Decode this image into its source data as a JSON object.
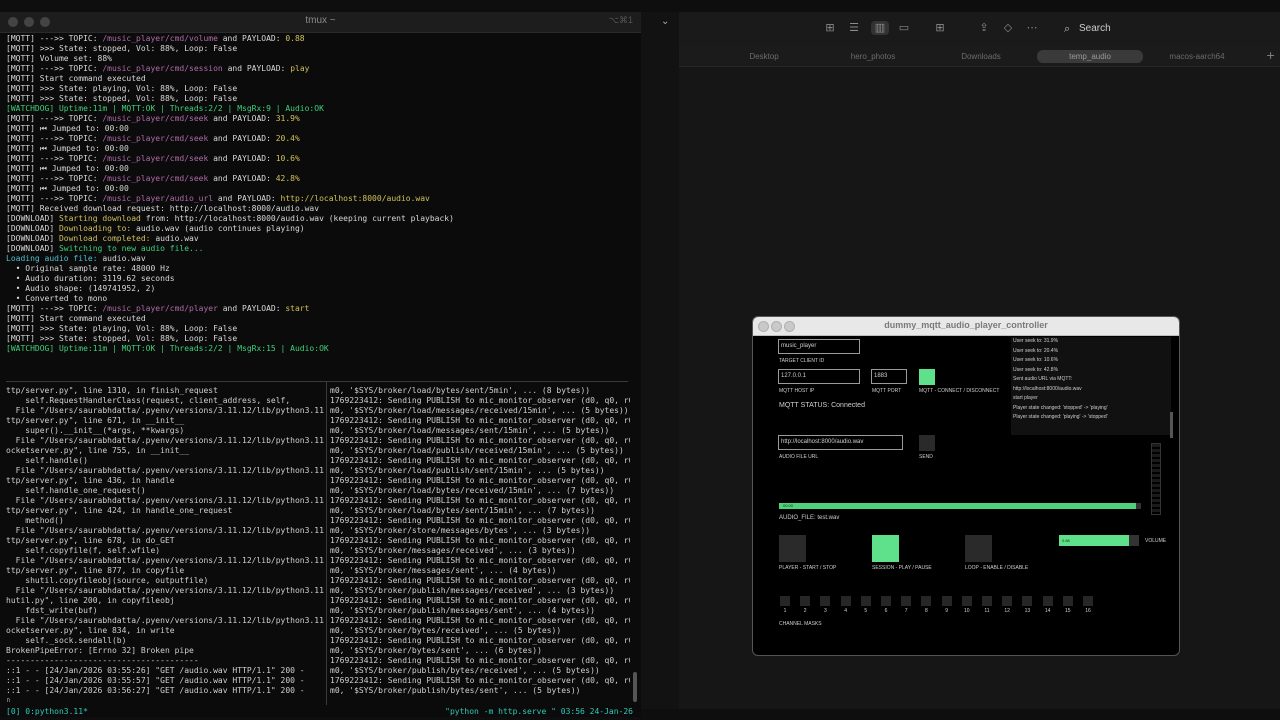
{
  "terminal": {
    "title": "tmux ~",
    "shortcut": "⌥⌘1",
    "top_lines": [
      [
        [
          "[MQTT] --->> TOPIC: ",
          ""
        ],
        [
          "/music_player/cmd/volume",
          "p"
        ],
        [
          " and PAYLOAD: ",
          ""
        ],
        [
          "0.88",
          "y"
        ]
      ],
      [
        [
          "[MQTT] >>> State: stopped, Vol: 88%, Loop: False",
          ""
        ]
      ],
      [
        [
          "[MQTT] Volume set: 88%",
          ""
        ]
      ],
      [
        [
          "[MQTT] --->> TOPIC: ",
          ""
        ],
        [
          "/music_player/cmd/session",
          "p"
        ],
        [
          " and PAYLOAD: ",
          ""
        ],
        [
          "play",
          "y"
        ]
      ],
      [
        [
          "[MQTT] Start command executed",
          ""
        ]
      ],
      [
        [
          "[MQTT] >>> State: playing, Vol: 88%, Loop: False",
          ""
        ]
      ],
      [
        [
          "[MQTT] >>> State: stopped, Vol: 88%, Loop: False",
          ""
        ]
      ],
      [
        [
          "[WATCHDOG] Uptime:11m | MQTT:OK | Threads:2/2 | MsgRx:9 | Audio:OK",
          "g"
        ]
      ],
      [
        [
          "[MQTT] --->> TOPIC: ",
          ""
        ],
        [
          "/music_player/cmd/seek",
          "p"
        ],
        [
          " and PAYLOAD: ",
          ""
        ],
        [
          "31.9%",
          "y"
        ]
      ],
      [
        [
          "[MQTT] ⏮ Jumped to: 00:00",
          ""
        ]
      ],
      [
        [
          "[MQTT] --->> TOPIC: ",
          ""
        ],
        [
          "/music_player/cmd/seek",
          "p"
        ],
        [
          " and PAYLOAD: ",
          ""
        ],
        [
          "20.4%",
          "y"
        ]
      ],
      [
        [
          "[MQTT] ⏮ Jumped to: 00:00",
          ""
        ]
      ],
      [
        [
          "[MQTT] --->> TOPIC: ",
          ""
        ],
        [
          "/music_player/cmd/seek",
          "p"
        ],
        [
          " and PAYLOAD: ",
          ""
        ],
        [
          "10.6%",
          "y"
        ]
      ],
      [
        [
          "[MQTT] ⏮ Jumped to: 00:00",
          ""
        ]
      ],
      [
        [
          "[MQTT] --->> TOPIC: ",
          ""
        ],
        [
          "/music_player/cmd/seek",
          "p"
        ],
        [
          " and PAYLOAD: ",
          ""
        ],
        [
          "42.8%",
          "y"
        ]
      ],
      [
        [
          "[MQTT] ⏮ Jumped to: 00:00",
          ""
        ]
      ],
      [
        [
          "[MQTT] --->> TOPIC: ",
          ""
        ],
        [
          "/music_player/audio_url",
          "p"
        ],
        [
          " and PAYLOAD: ",
          ""
        ],
        [
          "http://localhost:8000/audio.wav",
          "y"
        ]
      ],
      [
        [
          "[MQTT] Received download request: http://localhost:8000/audio.wav",
          ""
        ]
      ],
      [
        [
          "[DOWNLOAD] ",
          ""
        ],
        [
          "Starting download",
          "y"
        ],
        [
          " from: http://localhost:8000/audio.wav (keeping current playback)",
          ""
        ]
      ],
      [
        [
          "[DOWNLOAD] ",
          ""
        ],
        [
          "Downloading to:",
          "y"
        ],
        [
          " audio.wav (audio continues playing)",
          ""
        ]
      ],
      [
        [
          "[DOWNLOAD] ",
          ""
        ],
        [
          "Download completed:",
          "y"
        ],
        [
          " audio.wav",
          ""
        ]
      ],
      [
        [
          "[DOWNLOAD] ",
          ""
        ],
        [
          "Switching to new audio file...",
          "g"
        ]
      ],
      [
        [
          "Loading audio file:",
          "c"
        ],
        [
          " audio.wav",
          ""
        ]
      ],
      [
        [
          "  • Original sample rate: 48000 Hz",
          ""
        ]
      ],
      [
        [
          "  • Audio duration: 3119.62 seconds",
          ""
        ]
      ],
      [
        [
          "  • Audio shape: (149741952, 2)",
          ""
        ]
      ],
      [
        [
          "  • Converted to mono",
          ""
        ]
      ],
      [
        [
          "[MQTT] --->> TOPIC: ",
          ""
        ],
        [
          "/music_player/cmd/player",
          "p"
        ],
        [
          " and PAYLOAD: ",
          ""
        ],
        [
          "start",
          "y"
        ]
      ],
      [
        [
          "[MQTT] Start command executed",
          ""
        ]
      ],
      [
        [
          "[MQTT] >>> State: playing, Vol: 88%, Loop: False",
          ""
        ]
      ],
      [
        [
          "[MQTT] >>> State: stopped, Vol: 88%, Loop: False",
          ""
        ]
      ],
      [
        [
          "[WATCHDOG] Uptime:11m | MQTT:OK | Threads:2/2 | MsgRx:15 | Audio:OK",
          "g"
        ]
      ]
    ],
    "bottom_left_lines": [
      "ttp/server.py\", line 1310, in finish_request",
      "    self.RequestHandlerClass(request, client_address, self,",
      "  File \"/Users/saurabhdatta/.pyenv/versions/3.11.12/lib/python3.11/h",
      "ttp/server.py\", line 671, in __init__",
      "    super().__init__(*args, **kwargs)",
      "  File \"/Users/saurabhdatta/.pyenv/versions/3.11.12/lib/python3.11/s",
      "ocketserver.py\", line 755, in __init__",
      "    self.handle()",
      "  File \"/Users/saurabhdatta/.pyenv/versions/3.11.12/lib/python3.11/h",
      "ttp/server.py\", line 436, in handle",
      "    self.handle_one_request()",
      "  File \"/Users/saurabhdatta/.pyenv/versions/3.11.12/lib/python3.11/h",
      "ttp/server.py\", line 424, in handle_one_request",
      "    method()",
      "  File \"/Users/saurabhdatta/.pyenv/versions/3.11.12/lib/python3.11/h",
      "ttp/server.py\", line 678, in do_GET",
      "    self.copyfile(f, self.wfile)",
      "  File \"/Users/saurabhdatta/.pyenv/versions/3.11.12/lib/python3.11/h",
      "ttp/server.py\", line 877, in copyfile",
      "    shutil.copyfileobj(source, outputfile)",
      "  File \"/Users/saurabhdatta/.pyenv/versions/3.11.12/lib/python3.11/s",
      "hutil.py\", line 200, in copyfileobj",
      "    fdst_write(buf)",
      "  File \"/Users/saurabhdatta/.pyenv/versions/3.11.12/lib/python3.11/s",
      "ocketserver.py\", line 834, in write",
      "    self._sock.sendall(b)",
      "BrokenPipeError: [Errno 32] Broken pipe",
      "----------------------------------------",
      "::1 - - [24/Jan/2026 03:55:26] \"GET /audio.wav HTTP/1.1\" 200 -",
      "::1 - - [24/Jan/2026 03:55:57] \"GET /audio.wav HTTP/1.1\" 200 -",
      "::1 - - [24/Jan/2026 03:56:27] \"GET /audio.wav HTTP/1.1\" 200 -",
      "▯"
    ],
    "bottom_right_lines": [
      "m0, '$SYS/broker/load/bytes/sent/5min', ... (8 bytes))",
      "1769223412: Sending PUBLISH to mic_monitor_observer (d0, q0, r0,",
      "m0, '$SYS/broker/load/messages/received/15min', ... (5 bytes))",
      "1769223412: Sending PUBLISH to mic_monitor_observer (d0, q0, r0,",
      "m0, '$SYS/broker/load/messages/sent/15min', ... (5 bytes))",
      "1769223412: Sending PUBLISH to mic_monitor_observer (d0, q0, r0,",
      "m0, '$SYS/broker/load/publish/received/15min', ... (5 bytes))",
      "1769223412: Sending PUBLISH to mic_monitor_observer (d0, q0, r0,",
      "m0, '$SYS/broker/load/publish/sent/15min', ... (5 bytes))",
      "1769223412: Sending PUBLISH to mic_monitor_observer (d0, q0, r0,",
      "m0, '$SYS/broker/load/bytes/received/15min', ... (7 bytes))",
      "1769223412: Sending PUBLISH to mic_monitor_observer (d0, q0, r0,",
      "m0, '$SYS/broker/load/bytes/sent/15min', ... (7 bytes))",
      "1769223412: Sending PUBLISH to mic_monitor_observer (d0, q0, r0,",
      "m0, '$SYS/broker/store/messages/bytes', ... (3 bytes))",
      "1769223412: Sending PUBLISH to mic_monitor_observer (d0, q0, r0,",
      "m0, '$SYS/broker/messages/received', ... (3 bytes))",
      "1769223412: Sending PUBLISH to mic_monitor_observer (d0, q0, r0,",
      "m0, '$SYS/broker/messages/sent', ... (4 bytes))",
      "1769223412: Sending PUBLISH to mic_monitor_observer (d0, q0, r0,",
      "m0, '$SYS/broker/publish/messages/received', ... (3 bytes))",
      "1769223412: Sending PUBLISH to mic_monitor_observer (d0, q0, r0,",
      "m0, '$SYS/broker/publish/messages/sent', ... (4 bytes))",
      "1769223412: Sending PUBLISH to mic_monitor_observer (d0, q0, r0,",
      "m0, '$SYS/broker/bytes/received', ... (5 bytes))",
      "1769223412: Sending PUBLISH to mic_monitor_observer (d0, q0, r0,",
      "m0, '$SYS/broker/bytes/sent', ... (6 bytes))",
      "1769223412: Sending PUBLISH to mic_monitor_observer (d0, q0, r0,",
      "m0, '$SYS/broker/publish/bytes/received', ... (5 bytes))",
      "1769223412: Sending PUBLISH to mic_monitor_observer (d0, q0, r0,",
      "m0, '$SYS/broker/publish/bytes/sent', ... (5 bytes))"
    ],
    "status_left": "[0] 0:python3.11*",
    "status_right": "\"python -m http.serve \" 03:56 24-Jan-26"
  },
  "finder": {
    "search_label": "Search",
    "tabs": [
      "Desktop",
      "hero_photos",
      "Downloads",
      "temp_audio",
      "macos-aarch64"
    ],
    "active_tab": 3,
    "add_tab": "+"
  },
  "controller": {
    "title": "dummy_mqtt_audio_player_controller",
    "client_id_value": "music_player",
    "client_id_label": "TARGET CLIENT ID",
    "host_value": "127.0.0.1",
    "host_label": "MQTT HOST IP",
    "port_value": "1883",
    "port_label": "MQTT PORT",
    "connect_label": "MQTT - CONNECT / DISCONNECT",
    "status": "MQTT STATUS: Connected",
    "log_lines": [
      "User seek to: 31.9%",
      "User seek to: 20.4%",
      "User seek to: 10.6%",
      "User seek to: 42.8%",
      "Sent audio URL via MQTT:",
      "http://localhost:8000/audio.wav",
      "start player",
      "Player state changed: 'stopped' -> 'playing'",
      "Player state changed: 'playing' -> 'stopped'"
    ],
    "url_value": "http://localhost:8000/audio.wav",
    "url_label": "AUDIO FILE URL",
    "send_label": "SEND",
    "progress_text": "00:00",
    "progress_fraction": 0.985,
    "audio_file_label": "AUDIO_FILE: test.wav",
    "volume_text": "0.88",
    "volume_fraction": 0.88,
    "volume_label": "VOLUME",
    "player_label": "PLAYER - START / STOP",
    "session_label": "SESSION - PLAY / PAUSE",
    "loop_label": "LOOP - ENABLE / DISABLE",
    "channels": [
      "1",
      "2",
      "3",
      "4",
      "5",
      "6",
      "7",
      "8",
      "9",
      "10",
      "11",
      "12",
      "13",
      "14",
      "15",
      "16"
    ],
    "channel_masks_label": "CHANNEL MASKS",
    "colors": {
      "on": "#5fe08a",
      "off": "#2a2a2a"
    }
  }
}
